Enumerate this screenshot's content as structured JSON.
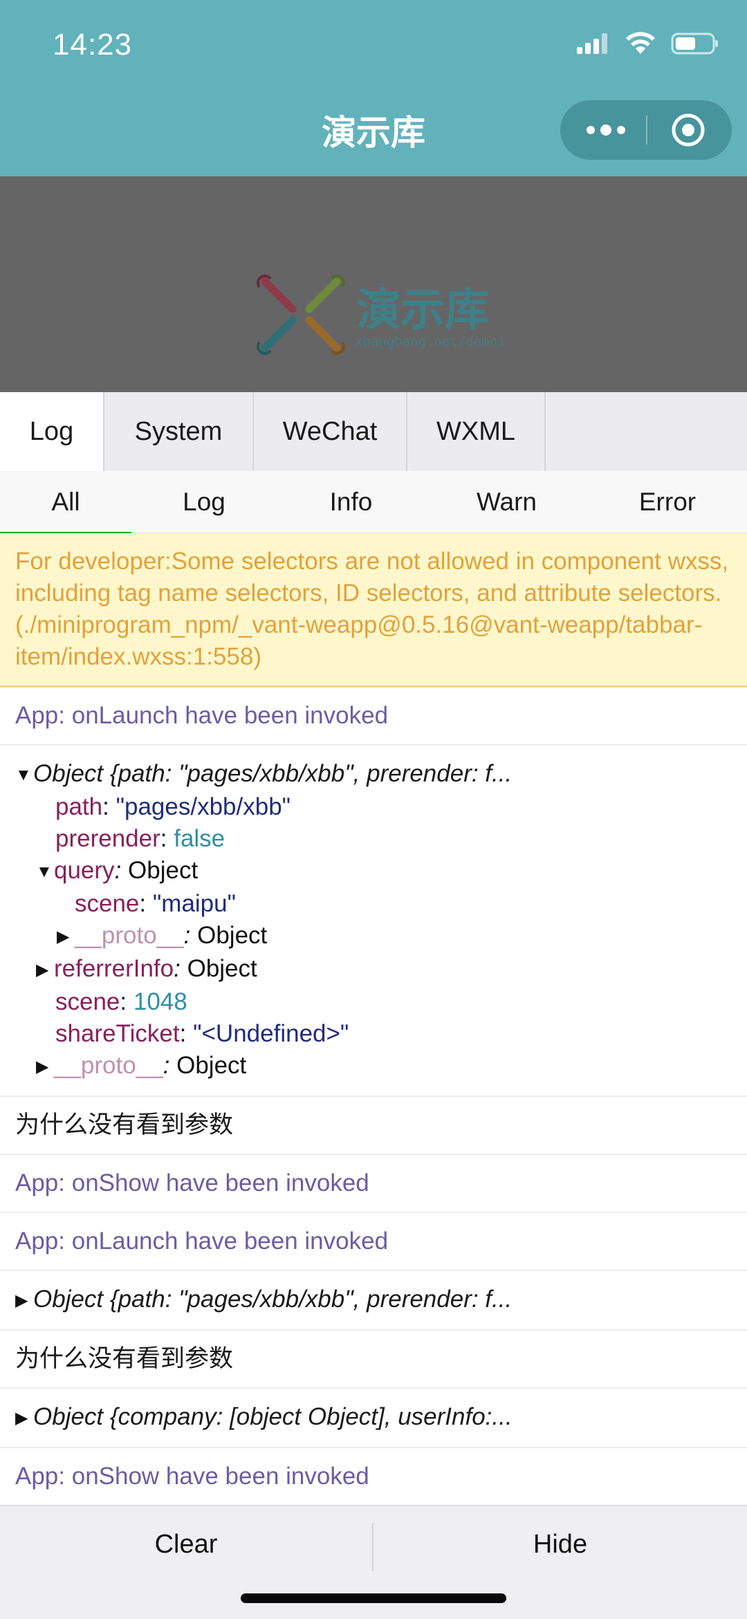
{
  "status_bar": {
    "time": "14:23"
  },
  "nav": {
    "title": "演示库"
  },
  "banner": {
    "logo_text": "演示库",
    "logo_sub": "xbangbang.net/demo1"
  },
  "tabs": [
    "Log",
    "System",
    "WeChat",
    "WXML"
  ],
  "subtabs": [
    "All",
    "Log",
    "Info",
    "Warn",
    "Error"
  ],
  "logs": {
    "warning": "For developer:Some selectors are not allowed in component wxss, including tag name selectors, ID selectors, and attribute selectors.(./miniprogram_npm/_vant-weapp@0.5.16@vant-weapp/tabbar-item/index.wxss:1:558)",
    "onlaunch1": "App: onLaunch have been invoked",
    "object1": {
      "summary": "Object {path: \"pages/xbb/xbb\", prerender: f...",
      "path_key": "path",
      "path_val": "\"pages/xbb/xbb\"",
      "prerender_key": "prerender",
      "prerender_val": "false",
      "query_key": "query",
      "query_val": "Object",
      "scene_key_inner": "scene",
      "scene_val_inner": "\"maipu\"",
      "proto_key": "__proto__",
      "proto_val": "Object",
      "referrer_key": "referrerInfo",
      "referrer_val": "Object",
      "scene_key": "scene",
      "scene_val": "1048",
      "shareticket_key": "shareTicket",
      "shareticket_val": "\"<Undefined>\"",
      "proto2_key": "__proto__",
      "proto2_val": "Object"
    },
    "question1": "为什么没有看到参数",
    "onshow1": "App: onShow have been invoked",
    "onlaunch2": "App: onLaunch have been invoked",
    "object2": "Object {path: \"pages/xbb/xbb\", prerender: f...",
    "question2": "为什么没有看到参数",
    "object3": "Object {company: [object Object], userInfo:...",
    "onshow2": "App: onShow have been invoked"
  },
  "bottom": {
    "clear_label": "Clear",
    "hide_label": "Hide"
  },
  "colors": {
    "nav_bg": "#62b2bb",
    "warn_bg": "#fff7cc",
    "warn_text": "#e3a13a",
    "info_text": "#6b5ca5"
  }
}
